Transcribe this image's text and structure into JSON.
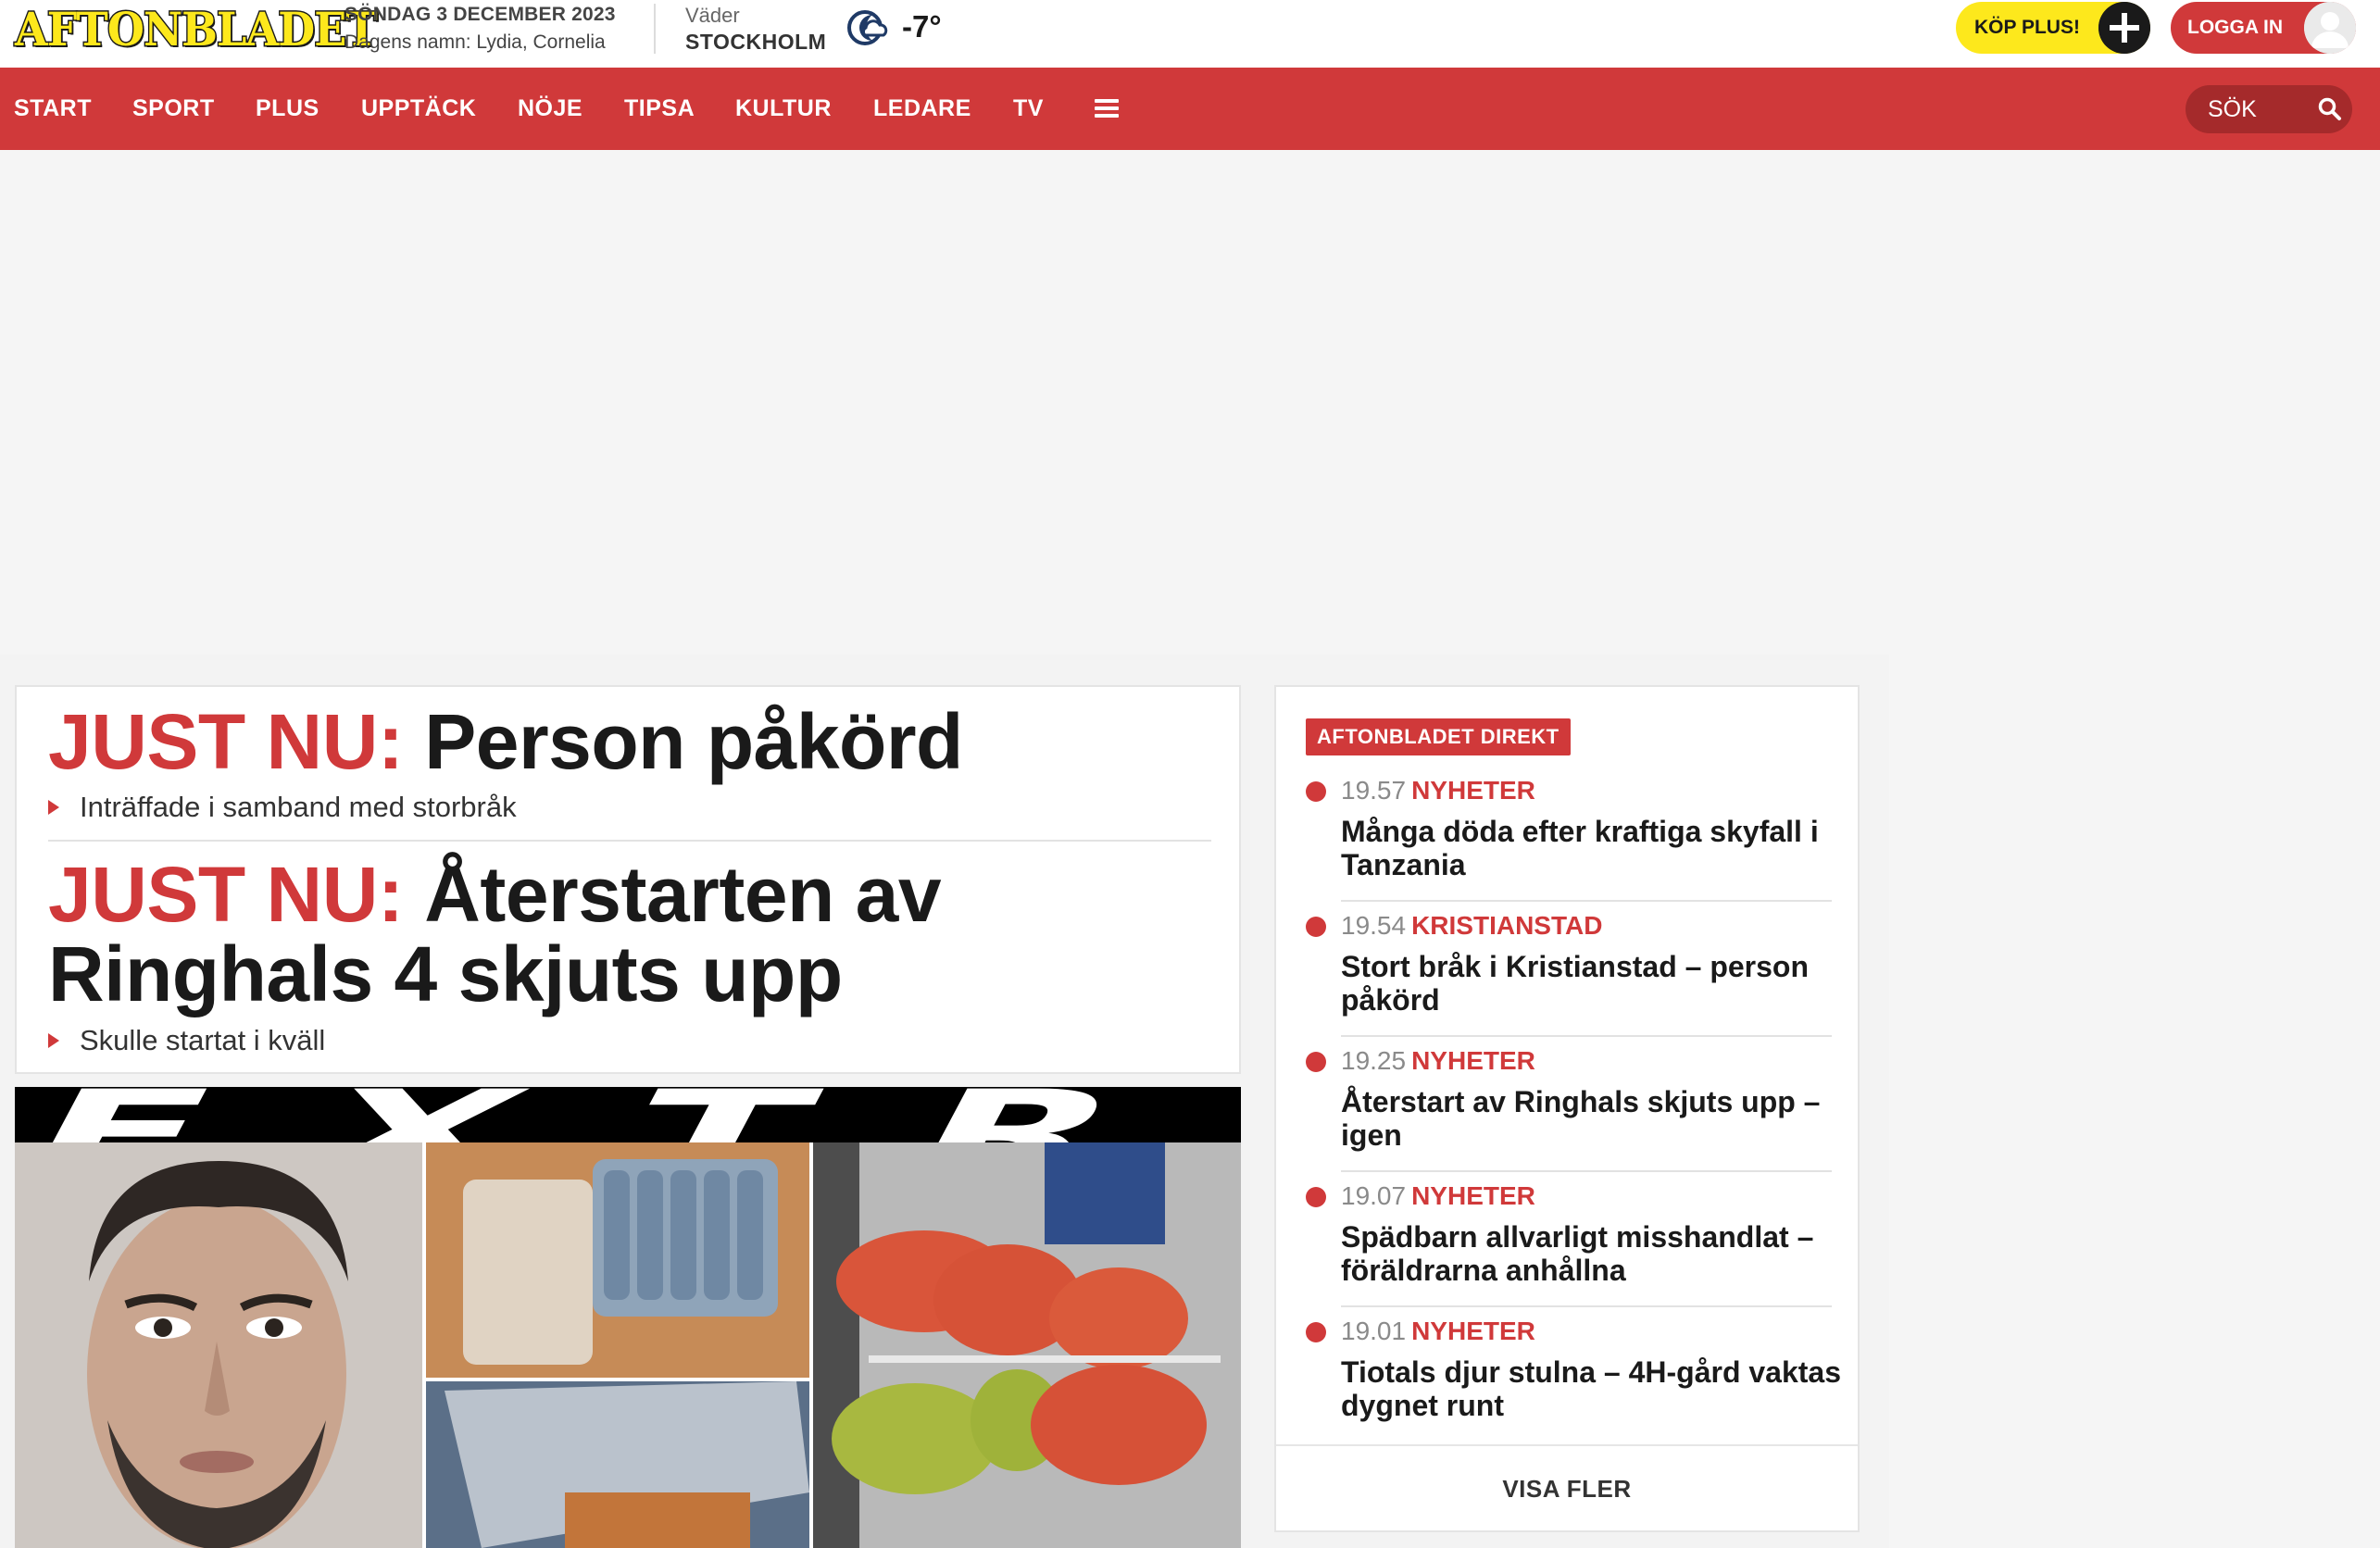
{
  "header": {
    "logo_text": "AFTONBLADET",
    "date": "SÖNDAG 3 DECEMBER 2023",
    "name_day": "Dagens namn: Lydia, Cornelia",
    "weather": {
      "label": "Väder",
      "city": "STOCKHOLM",
      "temperature": "-7°",
      "icon": "moon-cloud-icon"
    },
    "buy_plus_label": "KÖP PLUS!",
    "login_label": "LOGGA IN"
  },
  "nav": {
    "items": [
      "START",
      "SPORT",
      "PLUS",
      "UPPTÄCK",
      "NÖJE",
      "TIPSA",
      "KULTUR",
      "LEDARE",
      "TV"
    ],
    "menu_icon": "hamburger-icon",
    "search_label": "SÖK",
    "search_icon": "search-icon"
  },
  "just_nu": [
    {
      "prefix": "JUST NU:",
      "headline": "Person påkörd",
      "sub": "Inträffade i samband med storbråk"
    },
    {
      "prefix": "JUST NU:",
      "headline_line1": "Återstarten av",
      "headline_line2": "Ringhals 4 skjuts upp",
      "sub": "Skulle startat i kväll"
    }
  ],
  "extra_teaser": {
    "banner_text": "EXTRA"
  },
  "direkt": {
    "badge": "AFTONBLADET DIREKT",
    "items": [
      {
        "time": "19.57",
        "category": "NYHETER",
        "title": "Många döda efter kraftiga skyfall i Tanzania"
      },
      {
        "time": "19.54",
        "category": "KRISTIANSTAD",
        "title": "Stort bråk i Kristianstad – person påkörd"
      },
      {
        "time": "19.25",
        "category": "NYHETER",
        "title": "Återstart av Ringhals skjuts upp – igen"
      },
      {
        "time": "19.07",
        "category": "NYHETER",
        "title": "Spädbarn allvarligt misshandlat – föräldrarna anhållna"
      },
      {
        "time": "19.01",
        "category": "NYHETER",
        "title": "Tiotals djur stulna – 4H-gård vaktas dygnet runt"
      }
    ],
    "show_more_label": "VISA FLER"
  },
  "colors": {
    "brand_red": "#d0393a",
    "brand_yellow": "#fde81c",
    "text_dark": "#1a1a1a"
  }
}
